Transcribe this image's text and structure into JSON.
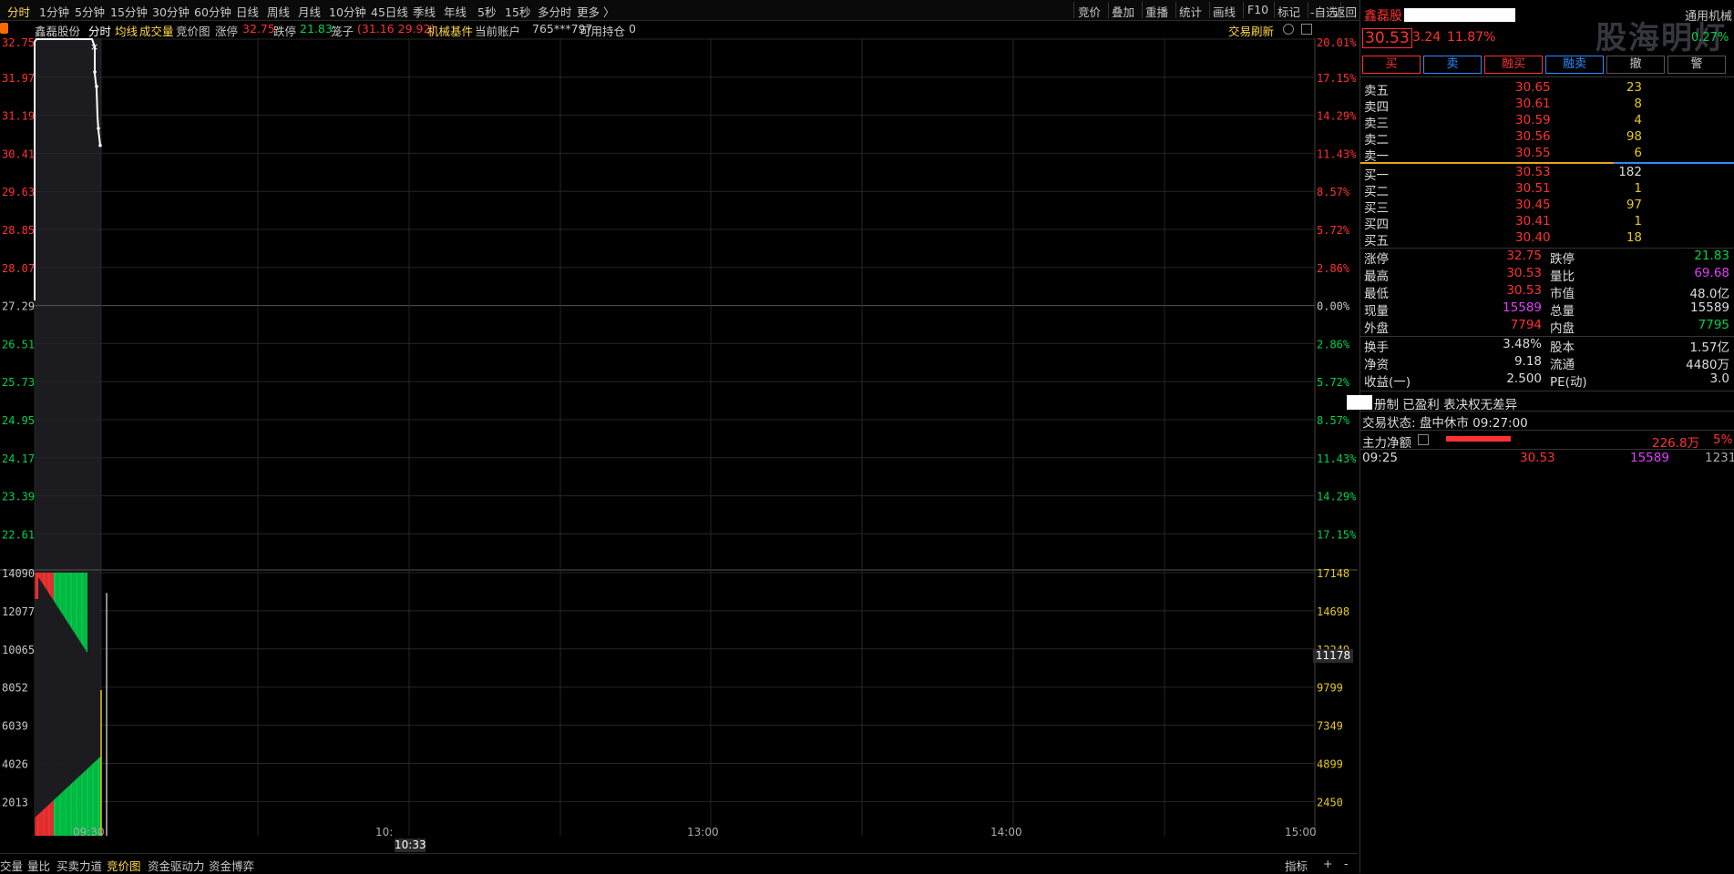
{
  "toolbar": {
    "periods": [
      "分时",
      "1分钟",
      "5分钟",
      "15分钟",
      "30分钟",
      "60分钟",
      "日线",
      "周线",
      "月线",
      "10分钟",
      "45日线",
      "季线",
      "年线",
      "5秒",
      "15秒",
      "多分时",
      "更多 〉"
    ],
    "active_period": "分时",
    "tools": [
      "竞价",
      "叠加",
      "重播",
      "统计",
      "画线",
      "F10",
      "标记",
      "-自选",
      "返回"
    ]
  },
  "info": {
    "stock_name": "鑫磊股份",
    "mode": "分时",
    "avg_line_label": "均线",
    "volume_label": "成交量",
    "auction_label": "竞价图",
    "limit_up_label": "涨停",
    "limit_up": "32.75",
    "limit_down_label": "跌停",
    "limit_down": "21.83",
    "cage_label": "笼子",
    "cage_value": "(31.16 29.92)",
    "sector": "机械基件",
    "account_label": "当前账户",
    "account": "765***797",
    "position_label": "可用持仓",
    "position": "0",
    "trade_refresh": "交易刷新"
  },
  "axes": {
    "price_left": [
      "32.75",
      "31.97",
      "31.19",
      "30.41",
      "29.63",
      "28.85",
      "28.07",
      "27.29",
      "26.51",
      "25.73",
      "24.95",
      "24.17",
      "23.39",
      "22.61"
    ],
    "pct_right": [
      "20.01%",
      "17.15%",
      "14.29%",
      "11.43%",
      "8.57%",
      "5.72%",
      "2.86%",
      "0.00%",
      "2.86%",
      "5.72%",
      "8.57%",
      "11.43%",
      "14.29%",
      "17.15%"
    ],
    "vol_left": [
      "14090",
      "12077",
      "10065",
      "8052",
      "6039",
      "4026",
      "2013"
    ],
    "vol_right": [
      "17148",
      "14698",
      "12249",
      "9799",
      "7349",
      "4899",
      "2450"
    ],
    "vol_cursor_value": "11178",
    "time_labels": [
      "09:30",
      "10:",
      "13:00",
      "14:00",
      "15:00"
    ],
    "cursor_time": "10:33"
  },
  "chart_data": {
    "type": "line",
    "price_line": {
      "x": [
        "09:15",
        "09:20",
        "09:24",
        "09:25"
      ],
      "y": [
        32.75,
        32.75,
        32.75,
        30.53
      ]
    },
    "prev_close": 27.29,
    "ylim_price": [
      22.22,
      32.75
    ],
    "volume_bars": {
      "ylim": [
        0,
        14090
      ],
      "description_values": [
        14090,
        14090,
        4026,
        13000
      ]
    }
  },
  "bottom_tabs": [
    "交量",
    "量比",
    "买卖力道",
    "竞价图",
    "资金驱动力",
    "资金博弈"
  ],
  "bottom_active": "竞价图",
  "bottom_right": [
    "指标",
    "+",
    "-"
  ],
  "panel": {
    "name": "鑫磊股",
    "sector": "通用机械",
    "price": "30.53",
    "change": "3.24",
    "change_pct": "11.87%",
    "sector_pct": "0.27%",
    "watermark": "股海明灯",
    "buttons": [
      "买",
      "卖",
      "融买",
      "融卖",
      "撤",
      "警"
    ],
    "asks": [
      {
        "label": "卖五",
        "price": "30.65",
        "vol": "23"
      },
      {
        "label": "卖四",
        "price": "30.61",
        "vol": "8"
      },
      {
        "label": "卖三",
        "price": "30.59",
        "vol": "4"
      },
      {
        "label": "卖二",
        "price": "30.56",
        "vol": "98"
      },
      {
        "label": "卖一",
        "price": "30.55",
        "vol": "6"
      }
    ],
    "bids": [
      {
        "label": "买一",
        "price": "30.53",
        "vol": "182"
      },
      {
        "label": "买二",
        "price": "30.51",
        "vol": "1"
      },
      {
        "label": "买三",
        "price": "30.45",
        "vol": "97"
      },
      {
        "label": "买四",
        "price": "30.41",
        "vol": "1"
      },
      {
        "label": "买五",
        "price": "30.40",
        "vol": "18"
      }
    ],
    "stats": [
      {
        "l1": "涨停",
        "v1": "32.75",
        "c1": "red",
        "l2": "跌停",
        "v2": "21.83",
        "c2": "green"
      },
      {
        "l1": "最高",
        "v1": "30.53",
        "c1": "red",
        "l2": "量比",
        "v2": "69.68",
        "c2": "magenta"
      },
      {
        "l1": "最低",
        "v1": "30.53",
        "c1": "red",
        "l2": "市值",
        "v2": "48.0亿",
        "c2": "white"
      },
      {
        "l1": "现量",
        "v1": "15589",
        "c1": "magenta",
        "l2": "总量",
        "v2": "15589",
        "c2": "white"
      },
      {
        "l1": "外盘",
        "v1": "7794",
        "c1": "red",
        "l2": "内盘",
        "v2": "7795",
        "c2": "green"
      }
    ],
    "stats2": [
      {
        "l1": "换手",
        "v1": "3.48%",
        "l2": "股本",
        "v2": "1.57亿"
      },
      {
        "l1": "净资",
        "v1": "9.18",
        "l2": "流通",
        "v2": "4480万"
      },
      {
        "l1": "收益(一)",
        "v1": "2.500",
        "l2": "PE(动)",
        "v2": "3.0"
      }
    ],
    "reg_text": "册制 已盈利 表决权无差异",
    "trade_status": "交易状态: 盘中休市 09:27:00",
    "main_net_label": "主力净额",
    "main_net_value": "226.8万",
    "main_net_pct": "5%",
    "tick": {
      "time": "09:25",
      "price": "30.53",
      "vol": "15589",
      "count": "1231"
    }
  }
}
